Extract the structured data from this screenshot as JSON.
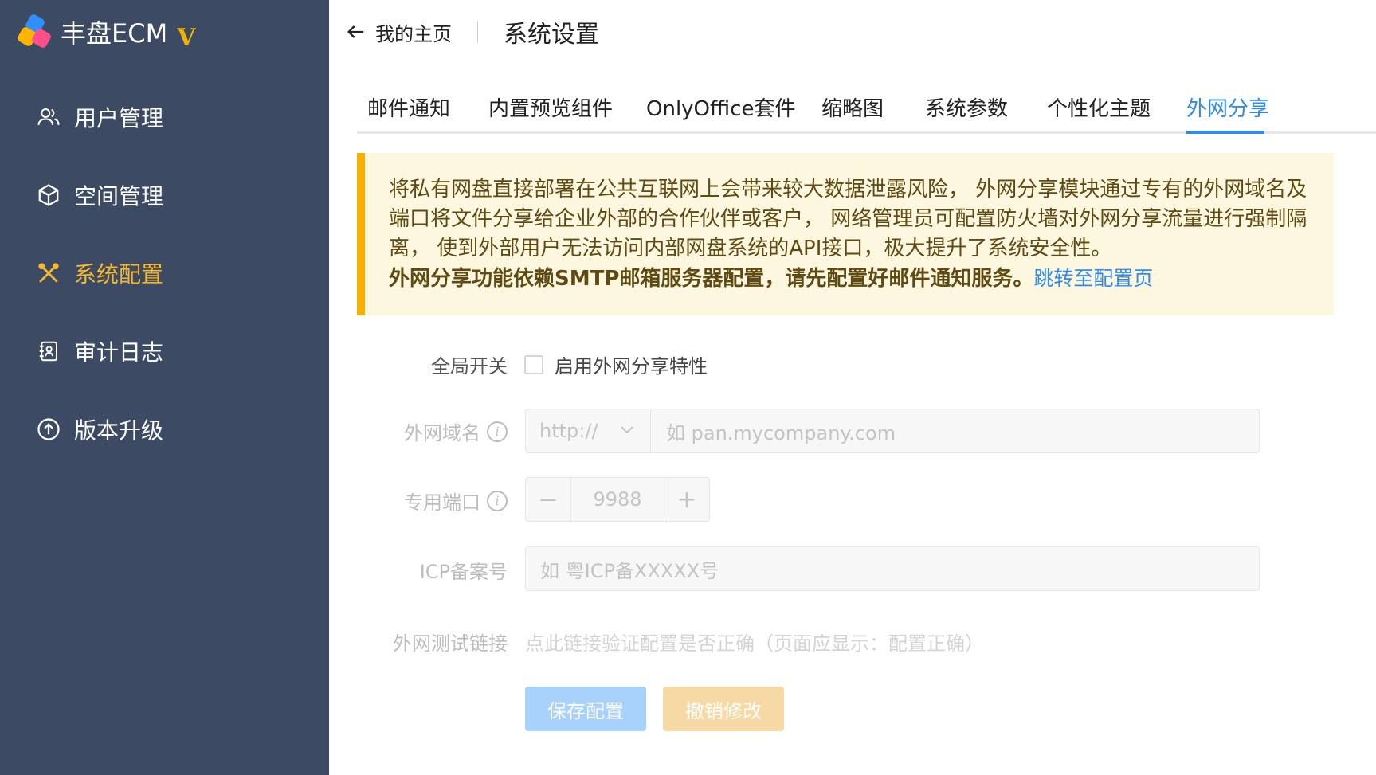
{
  "sidebar": {
    "brand": "丰盘ECM",
    "version_badge": "V",
    "items": [
      {
        "label": "用户管理",
        "icon": "users-icon",
        "active": false
      },
      {
        "label": "空间管理",
        "icon": "cube-icon",
        "active": false
      },
      {
        "label": "系统配置",
        "icon": "tools-icon",
        "active": true
      },
      {
        "label": "审计日志",
        "icon": "audit-log-icon",
        "active": false
      },
      {
        "label": "版本升级",
        "icon": "upgrade-icon",
        "active": false
      }
    ]
  },
  "header": {
    "back_label": "我的主页",
    "title": "系统设置"
  },
  "tabs": [
    {
      "label": "邮件通知"
    },
    {
      "label": "内置预览组件"
    },
    {
      "label": "OnlyOffice套件"
    },
    {
      "label": "缩略图"
    },
    {
      "label": "系统参数"
    },
    {
      "label": "个性化主题"
    },
    {
      "label": "外网分享",
      "active": true
    }
  ],
  "alert": {
    "text": "将私有网盘直接部署在公共互联网上会带来较大数据泄露风险， 外网分享模块通过专有的外网域名及端口将文件分享给企业外部的合作伙伴或客户， 网络管理员可配置防火墙对外网分享流量进行强制隔离， 使到外部用户无法访问内部网盘系统的API接口，极大提升了系统安全性。",
    "bold_text": "外网分享功能依赖SMTP邮箱服务器配置，请先配置好邮件通知服务。",
    "link_text": "跳转至配置页"
  },
  "form": {
    "global_switch_label": "全局开关",
    "enable_checkbox_label": "启用外网分享特性",
    "domain_label": "外网域名",
    "protocol_value": "http://",
    "domain_placeholder": "如 pan.mycompany.com",
    "port_label": "专用端口",
    "port_value": "9988",
    "minus": "−",
    "plus": "+",
    "icp_label": "ICP备案号",
    "icp_placeholder": "如 粤ICP备XXXXX号",
    "test_link_label": "外网测试链接",
    "test_link_text": "点此链接验证配置是否正确（页面应显示：配置正确）"
  },
  "actions": {
    "save_label": "保存配置",
    "cancel_label": "撤销修改"
  },
  "colors": {
    "sidebar_bg": "#3d4a63",
    "accent_blue": "#2f8bf0",
    "active_nav": "#f5b82e",
    "alert_bg": "#fdf7df",
    "alert_border": "#f5b000"
  }
}
